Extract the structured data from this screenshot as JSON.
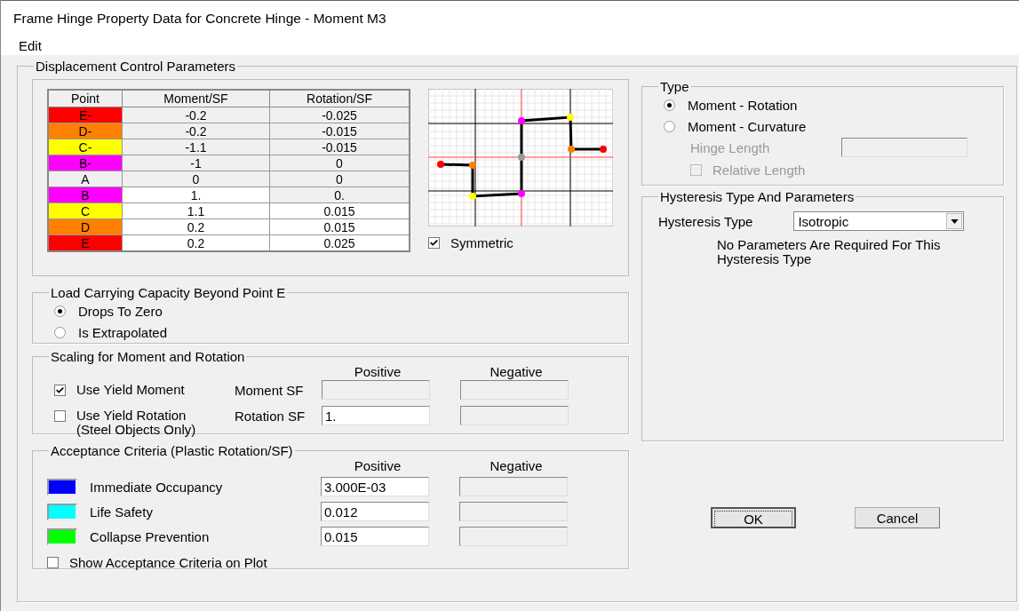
{
  "window": {
    "title": "Frame Hinge Property Data for Concrete Hinge - Moment M3"
  },
  "menu": [
    "Edit"
  ],
  "displacement": {
    "title": "Displacement Control Parameters",
    "columns": [
      "Point",
      "Moment/SF",
      "Rotation/SF"
    ],
    "rows": [
      {
        "cells": [
          {
            "text": "E-",
            "color": "#ff0000"
          },
          {
            "text": "-0.2",
            "editable": false
          },
          {
            "text": "-0.025",
            "editable": false
          }
        ]
      },
      {
        "cells": [
          {
            "text": "D-",
            "color": "#ff8000"
          },
          {
            "text": "-0.2",
            "editable": false
          },
          {
            "text": "-0.015",
            "editable": false
          }
        ]
      },
      {
        "cells": [
          {
            "text": "C-",
            "color": "#ffff00"
          },
          {
            "text": "-1.1",
            "editable": false
          },
          {
            "text": "-0.015",
            "editable": false
          }
        ]
      },
      {
        "cells": [
          {
            "text": "B-",
            "color": "#ff00ff"
          },
          {
            "text": "-1",
            "editable": false
          },
          {
            "text": "0",
            "editable": false
          }
        ]
      },
      {
        "cells": [
          {
            "text": "A",
            "color": "#f0f0f0"
          },
          {
            "text": "0",
            "editable": false
          },
          {
            "text": "0",
            "editable": false
          }
        ]
      },
      {
        "cells": [
          {
            "text": "B",
            "color": "#ff00ff"
          },
          {
            "text": "1.",
            "editable": true
          },
          {
            "text": "0.",
            "editable": false
          }
        ]
      },
      {
        "cells": [
          {
            "text": "C",
            "color": "#ffff00"
          },
          {
            "text": "1.1",
            "editable": true
          },
          {
            "text": "0.015",
            "editable": true
          }
        ]
      },
      {
        "cells": [
          {
            "text": "D",
            "color": "#ff8000"
          },
          {
            "text": "0.2",
            "editable": true
          },
          {
            "text": "0.015",
            "editable": true
          }
        ]
      },
      {
        "cells": [
          {
            "text": "E",
            "color": "#ff0000"
          },
          {
            "text": "0.2",
            "editable": true
          },
          {
            "text": "0.025",
            "editable": true
          }
        ]
      }
    ],
    "symmetric": {
      "label": "Symmetric",
      "checked": true
    }
  },
  "load_capacity": {
    "title": "Load Carrying Capacity Beyond Point E",
    "options": [
      {
        "label": "Drops To Zero",
        "selected": true
      },
      {
        "label": "Is Extrapolated",
        "selected": false
      }
    ]
  },
  "scaling": {
    "title": "Scaling for Moment and Rotation",
    "headers": [
      "Positive",
      "Negative"
    ],
    "rows": [
      {
        "label": "Use Yield Moment",
        "checked": true,
        "field_label": "Moment SF",
        "positive": {
          "disabled": true
        },
        "negative": {
          "disabled": true
        }
      },
      {
        "label": "Use Yield Rotation",
        "note": "(Steel Objects Only)",
        "checked": false,
        "field_label": "Rotation SF",
        "positive": {
          "value": "1.",
          "disabled": false
        },
        "negative": {
          "disabled": true
        }
      }
    ]
  },
  "acceptance": {
    "title": "Acceptance Criteria (Plastic Rotation/SF)",
    "headers": [
      "Positive",
      "Negative"
    ],
    "rows": [
      {
        "label": "Immediate Occupancy",
        "color": "#0000ff",
        "positive": {
          "value": "3.000E-03",
          "disabled": false
        },
        "negative": {
          "disabled": true
        }
      },
      {
        "label": "Life Safety",
        "color": "#00ffff",
        "positive": {
          "value": "0.012",
          "disabled": false
        },
        "negative": {
          "disabled": true
        }
      },
      {
        "label": "Collapse Prevention",
        "color": "#00ff00",
        "positive": {
          "value": "0.015",
          "disabled": false
        },
        "negative": {
          "disabled": true
        }
      }
    ],
    "show_on_plot": {
      "label": "Show Acceptance Criteria on Plot",
      "checked": false
    }
  },
  "type": {
    "title": "Type",
    "options": [
      {
        "label": "Moment - Rotation",
        "selected": true
      },
      {
        "label": "Moment - Curvature",
        "selected": false
      }
    ],
    "hinge_length": {
      "label": "Hinge Length",
      "disabled": true
    },
    "relative_length": {
      "label": "Relative Length",
      "checked": false,
      "disabled": true
    }
  },
  "hysteresis": {
    "title": "Hysteresis Type And Parameters",
    "type_label": "Hysteresis Type",
    "type_value": "Isotropic",
    "note": "No Parameters Are Required For This Hysteresis Type"
  },
  "buttons": [
    {
      "label": "OK",
      "default": true
    },
    {
      "label": "Cancel",
      "default": false
    }
  ]
}
